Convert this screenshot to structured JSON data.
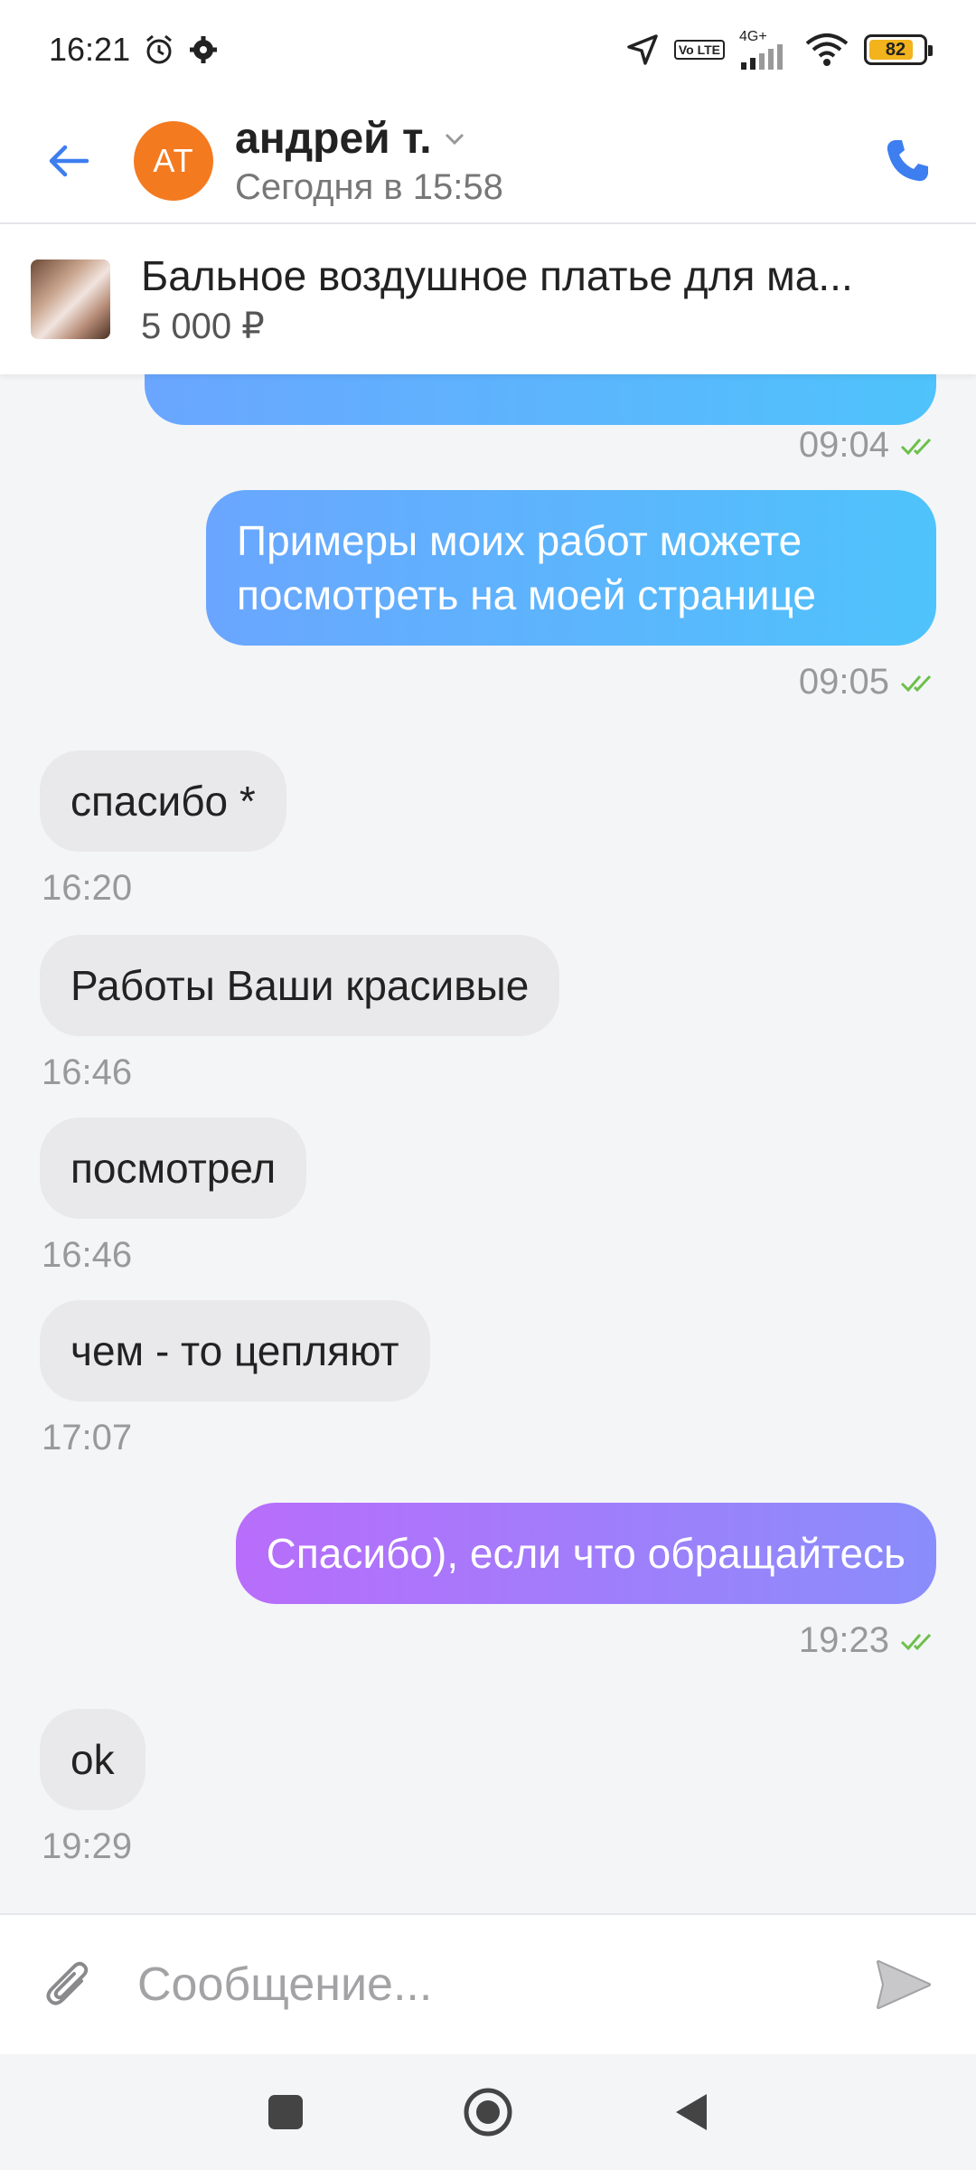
{
  "status_bar": {
    "time": "16:21",
    "network": "4G+",
    "volte": "Vo LTE",
    "battery": "82",
    "battery_level": 0.82
  },
  "header": {
    "avatar_initials": "АТ",
    "name": "андрей т.",
    "last_seen": "Сегодня в 15:58"
  },
  "item": {
    "title": "Бальное воздушное платье для ма...",
    "price": "5 000 ₽"
  },
  "messages": [
    {
      "direction": "out",
      "text": "",
      "time": "09:04",
      "read": true
    },
    {
      "direction": "out",
      "text": "Примеры моих работ можете посмотреть на моей странице",
      "time": "09:05",
      "read": true
    },
    {
      "direction": "in",
      "text": "спасибо *",
      "time": "16:20"
    },
    {
      "direction": "in",
      "text": "Работы Ваши красивые",
      "time": "16:46"
    },
    {
      "direction": "in",
      "text": "посмотрел",
      "time": "16:46"
    },
    {
      "direction": "in",
      "text": "чем - то цепляют",
      "time": "17:07"
    },
    {
      "direction": "out",
      "text": "Спасибо), если что обращайтесь",
      "time": "19:23",
      "read": true
    },
    {
      "direction": "in",
      "text": "ok",
      "time": "19:29"
    }
  ],
  "input": {
    "placeholder": "Сообщение..."
  },
  "colors": {
    "accent": "#3d7ef0",
    "avatar": "#f47a20",
    "read_check": "#6cc04a"
  },
  "icons": {
    "back": "arrow-left-icon",
    "call": "phone-icon",
    "attach": "paperclip-icon",
    "send": "send-icon"
  }
}
